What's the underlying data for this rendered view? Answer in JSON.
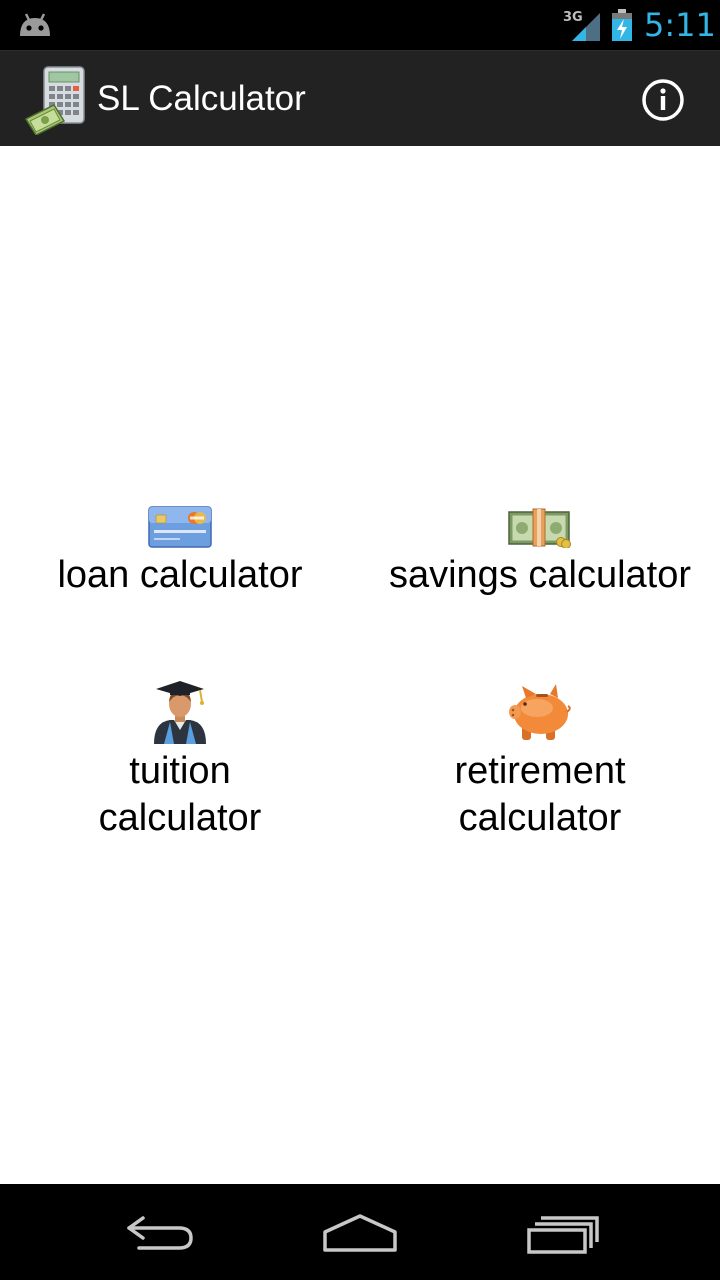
{
  "status_bar": {
    "network_type": "3G",
    "time": "5:11",
    "clock_color": "#33b5e5"
  },
  "action_bar": {
    "title": "SL Calculator",
    "info_icon": "info-icon"
  },
  "tiles": [
    {
      "label": "loan calculator",
      "icon": "credit-card-icon"
    },
    {
      "label": "savings calculator",
      "icon": "cash-stack-icon"
    },
    {
      "label": "tuition calculator",
      "icon": "graduate-icon"
    },
    {
      "label": "retirement calculator",
      "icon": "piggy-bank-icon"
    }
  ],
  "nav_bar": {
    "back_icon": "back-icon",
    "home_icon": "home-icon",
    "recents_icon": "recents-icon"
  }
}
